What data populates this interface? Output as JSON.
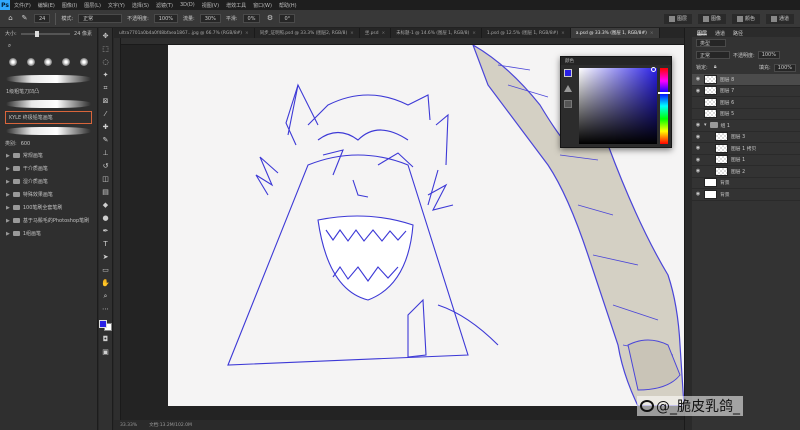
{
  "menubar": {
    "app_logo": "Ps",
    "items": [
      "文件(F)",
      "编辑(E)",
      "图像(I)",
      "图层(L)",
      "文字(Y)",
      "选择(S)",
      "滤镜(T)",
      "3D(D)",
      "视图(V)",
      "增效工具",
      "窗口(W)",
      "帮助(H)"
    ]
  },
  "options": {
    "brush_size": "24",
    "mode_label": "模式:",
    "mode_value": "正常",
    "opacity_label": "不透明度:",
    "opacity_value": "100%",
    "flow_label": "流量:",
    "flow_value": "30%",
    "smoothing_label": "平滑:",
    "smoothing_value": "0%",
    "angle_value": "0°",
    "right_items": [
      "图层",
      "图像",
      "颜色",
      "通道"
    ]
  },
  "brush_panel": {
    "size_label": "大小:",
    "size_value": "24 像素",
    "preset_title": "1级粗笔刀凹凸",
    "selected_preset": "KYLE 终极铅笔画笔",
    "stroke_label": "类别:",
    "stroke_value": "600",
    "folders": [
      "常规画笔",
      "干介质画笔",
      "湿介质画笔",
      "特殊效果画笔",
      "100笔刷全套笔刷",
      "基于马鬃毛的Photoshop笔刷",
      "1组画笔"
    ]
  },
  "tabs": [
    {
      "label": "ultra7701a0b4a0f48bfaea1867...jpg @ 66.7% (RGB/8#)",
      "active": false
    },
    {
      "label": "同步_证明照.psd @ 33.3% (图层2, RGB/8)",
      "active": false
    },
    {
      "label": "坐.psd",
      "active": false
    },
    {
      "label": "未标题-1 @ 14.6% (图层 1, RGB/8)",
      "active": false
    },
    {
      "label": "1.psd @ 12.5% (图层 1, RGB/8#)",
      "active": false
    },
    {
      "label": "a.psd @ 33.3% (图层 1, RGB/8#)",
      "active": true
    }
  ],
  "status": {
    "zoom": "33.33%",
    "doc": "文档:13.2M/102.0M"
  },
  "color_popup": {
    "title": "颜色",
    "fg_color": "#2a20e6"
  },
  "layers_panel": {
    "tabs": [
      "图层",
      "通道",
      "路径"
    ],
    "kind_label": "类型",
    "blend_mode": "正常",
    "opacity_label": "不透明度:",
    "opacity_value": "100%",
    "lock_label": "锁定:",
    "fill_label": "填充:",
    "fill_value": "100%",
    "layers": [
      {
        "name": "图层 8",
        "selected": true,
        "indent": false,
        "kind": "layer"
      },
      {
        "name": "图层 7",
        "selected": false,
        "indent": false,
        "kind": "layer"
      },
      {
        "name": "图层 6",
        "selected": false,
        "indent": false,
        "kind": "layer"
      },
      {
        "name": "图层 5",
        "selected": false,
        "indent": false,
        "kind": "layer"
      },
      {
        "name": "组 1",
        "selected": false,
        "indent": false,
        "kind": "group"
      },
      {
        "name": "图层 3",
        "selected": false,
        "indent": true,
        "kind": "layer"
      },
      {
        "name": "图层 1 拷贝",
        "selected": false,
        "indent": true,
        "kind": "layer"
      },
      {
        "name": "图层 1",
        "selected": false,
        "indent": true,
        "kind": "layer"
      },
      {
        "name": "图层 2",
        "selected": false,
        "indent": true,
        "kind": "layer"
      },
      {
        "name": "背景",
        "selected": false,
        "indent": false,
        "kind": "white"
      },
      {
        "name": "背景",
        "selected": false,
        "indent": false,
        "kind": "white"
      }
    ]
  },
  "watermark": "@_脆皮乳鸽_"
}
